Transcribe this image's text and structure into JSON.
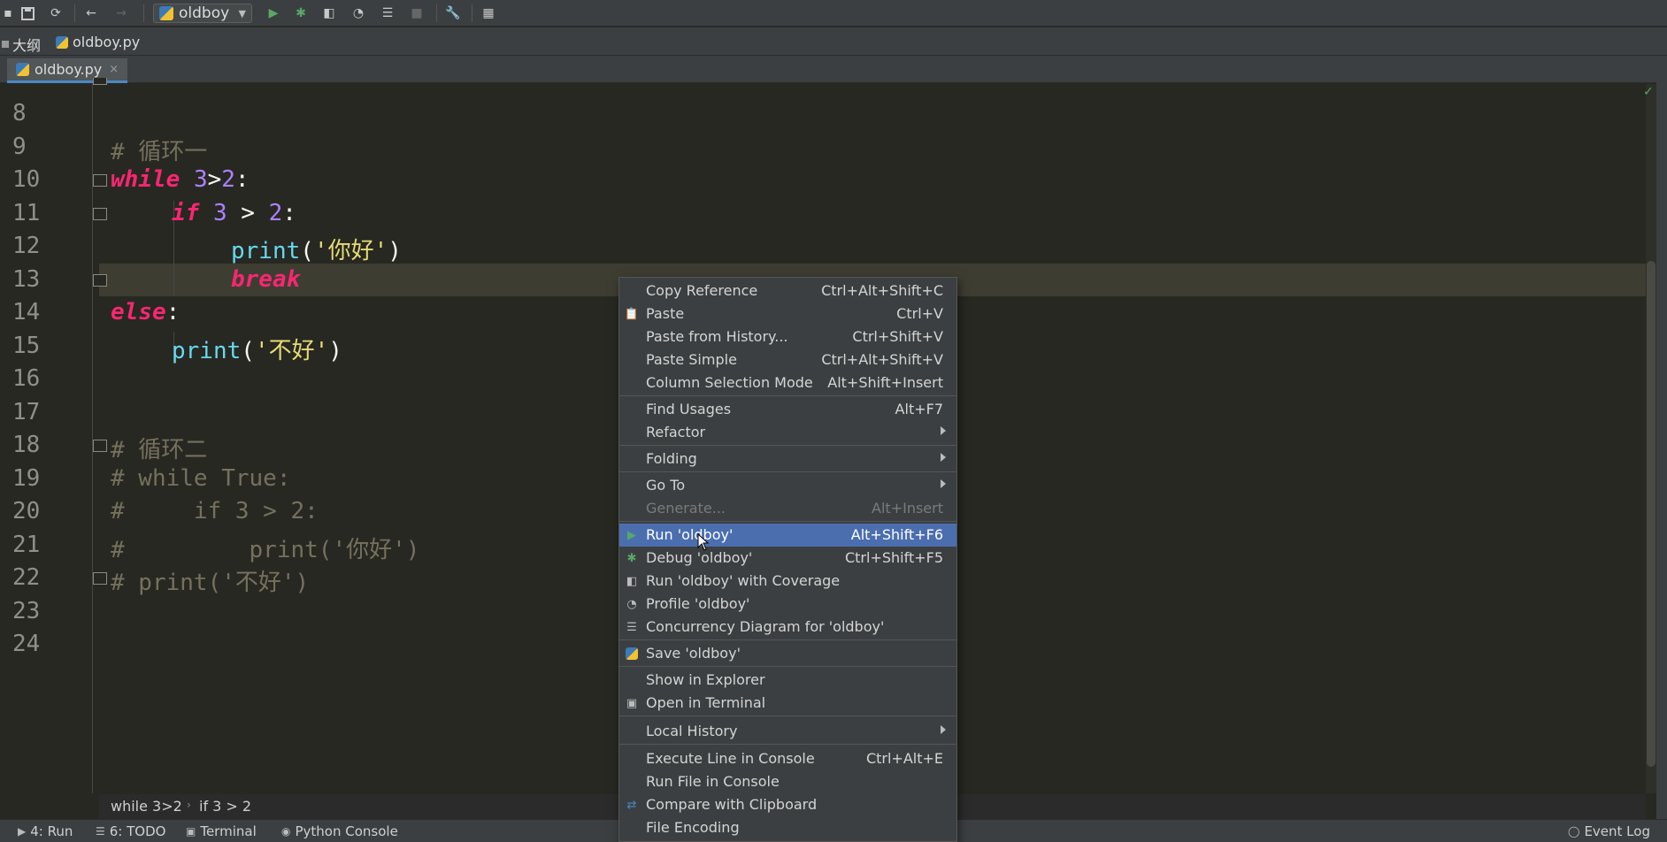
{
  "toolbar": {
    "run_config": "oldboy",
    "icons": [
      "menu-icon",
      "save-icon",
      "sync-icon",
      "back-icon",
      "forward-icon",
      "run-icon",
      "debug-icon",
      "coverage-icon",
      "profile-icon",
      "concurrency-icon",
      "stop-icon",
      "settings-icon",
      "structure-icon"
    ]
  },
  "breadcrumb": {
    "project": "大纲",
    "file": "oldboy.py"
  },
  "tab": {
    "label": "oldboy.py",
    "close": "×"
  },
  "editor": {
    "line_numbers": [
      "8",
      "9",
      "10",
      "11",
      "12",
      "13",
      "14",
      "15",
      "16",
      "17",
      "18",
      "19",
      "20",
      "21",
      "22",
      "23",
      "24"
    ],
    "lines": {
      "l9": "# 循环一",
      "l10_kw": "while",
      "l10_a": "3",
      "l10_op": ">",
      "l10_b": "2",
      "l10_colon": ":",
      "l11_kw": "if",
      "l11_a": "3",
      "l11_op": " > ",
      "l11_b": "2",
      "l11_colon": ":",
      "l12_fn": "print",
      "l12_p1": "(",
      "l12_str": "'你好'",
      "l12_p2": ")",
      "l13_kw": "break",
      "l14_kw": "else",
      "l14_colon": ":",
      "l15_fn": "print",
      "l15_p1": "(",
      "l15_str": "'不好'",
      "l15_p2": ")",
      "l18": "# 循环二",
      "l19": "# while True:",
      "l20": "#     if 3 > 2:",
      "l21": "#         print('你好')",
      "l22": "# print('不好')"
    }
  },
  "structure_path": [
    "while 3>2",
    "if 3 > 2"
  ],
  "statusbar": {
    "run": "4: Run",
    "todo": "6: TODO",
    "terminal": "Terminal",
    "python_console": "Python Console",
    "event_log": "Event Log"
  },
  "context_menu": {
    "items": [
      {
        "label": "Copy Reference",
        "shortcut": "Ctrl+Alt+Shift+C"
      },
      {
        "label": "Paste",
        "shortcut": "Ctrl+V",
        "icon": "clipboard-icon"
      },
      {
        "label": "Paste from History...",
        "shortcut": "Ctrl+Shift+V"
      },
      {
        "label": "Paste Simple",
        "shortcut": "Ctrl+Alt+Shift+V"
      },
      {
        "label": "Column Selection Mode",
        "shortcut": "Alt+Shift+Insert"
      },
      {
        "label": "Find Usages",
        "shortcut": "Alt+F7"
      },
      {
        "label": "Refactor",
        "submenu": true
      },
      {
        "label": "Folding",
        "submenu": true
      },
      {
        "label": "Go To",
        "submenu": true
      },
      {
        "label": "Generate...",
        "shortcut": "Alt+Insert",
        "disabled": true
      },
      {
        "label": "Run 'oldboy'",
        "shortcut": "Alt+Shift+F6",
        "icon": "run-icon",
        "selected": true
      },
      {
        "label": "Debug 'oldboy'",
        "shortcut": "Ctrl+Shift+F5",
        "icon": "debug-icon"
      },
      {
        "label": "Run 'oldboy' with Coverage",
        "icon": "coverage-icon"
      },
      {
        "label": "Profile 'oldboy'",
        "icon": "profile-icon"
      },
      {
        "label": "Concurrency Diagram for 'oldboy'",
        "icon": "concurrency-icon"
      },
      {
        "label": "Save 'oldboy'",
        "icon": "python-icon"
      },
      {
        "label": "Show in Explorer"
      },
      {
        "label": "Open in Terminal",
        "icon": "terminal-icon"
      },
      {
        "label": "Local History",
        "submenu": true
      },
      {
        "label": "Execute Line in Console",
        "shortcut": "Ctrl+Alt+E"
      },
      {
        "label": "Run File in Console"
      },
      {
        "label": "Compare with Clipboard",
        "icon": "compare-icon"
      },
      {
        "label": "File Encoding"
      }
    ]
  },
  "colors": {
    "keyword": "#f92672",
    "number": "#ae81ff",
    "function": "#66d9ef",
    "string": "#e6db74",
    "comment": "#75715e",
    "selection": "#4b6eaf"
  }
}
